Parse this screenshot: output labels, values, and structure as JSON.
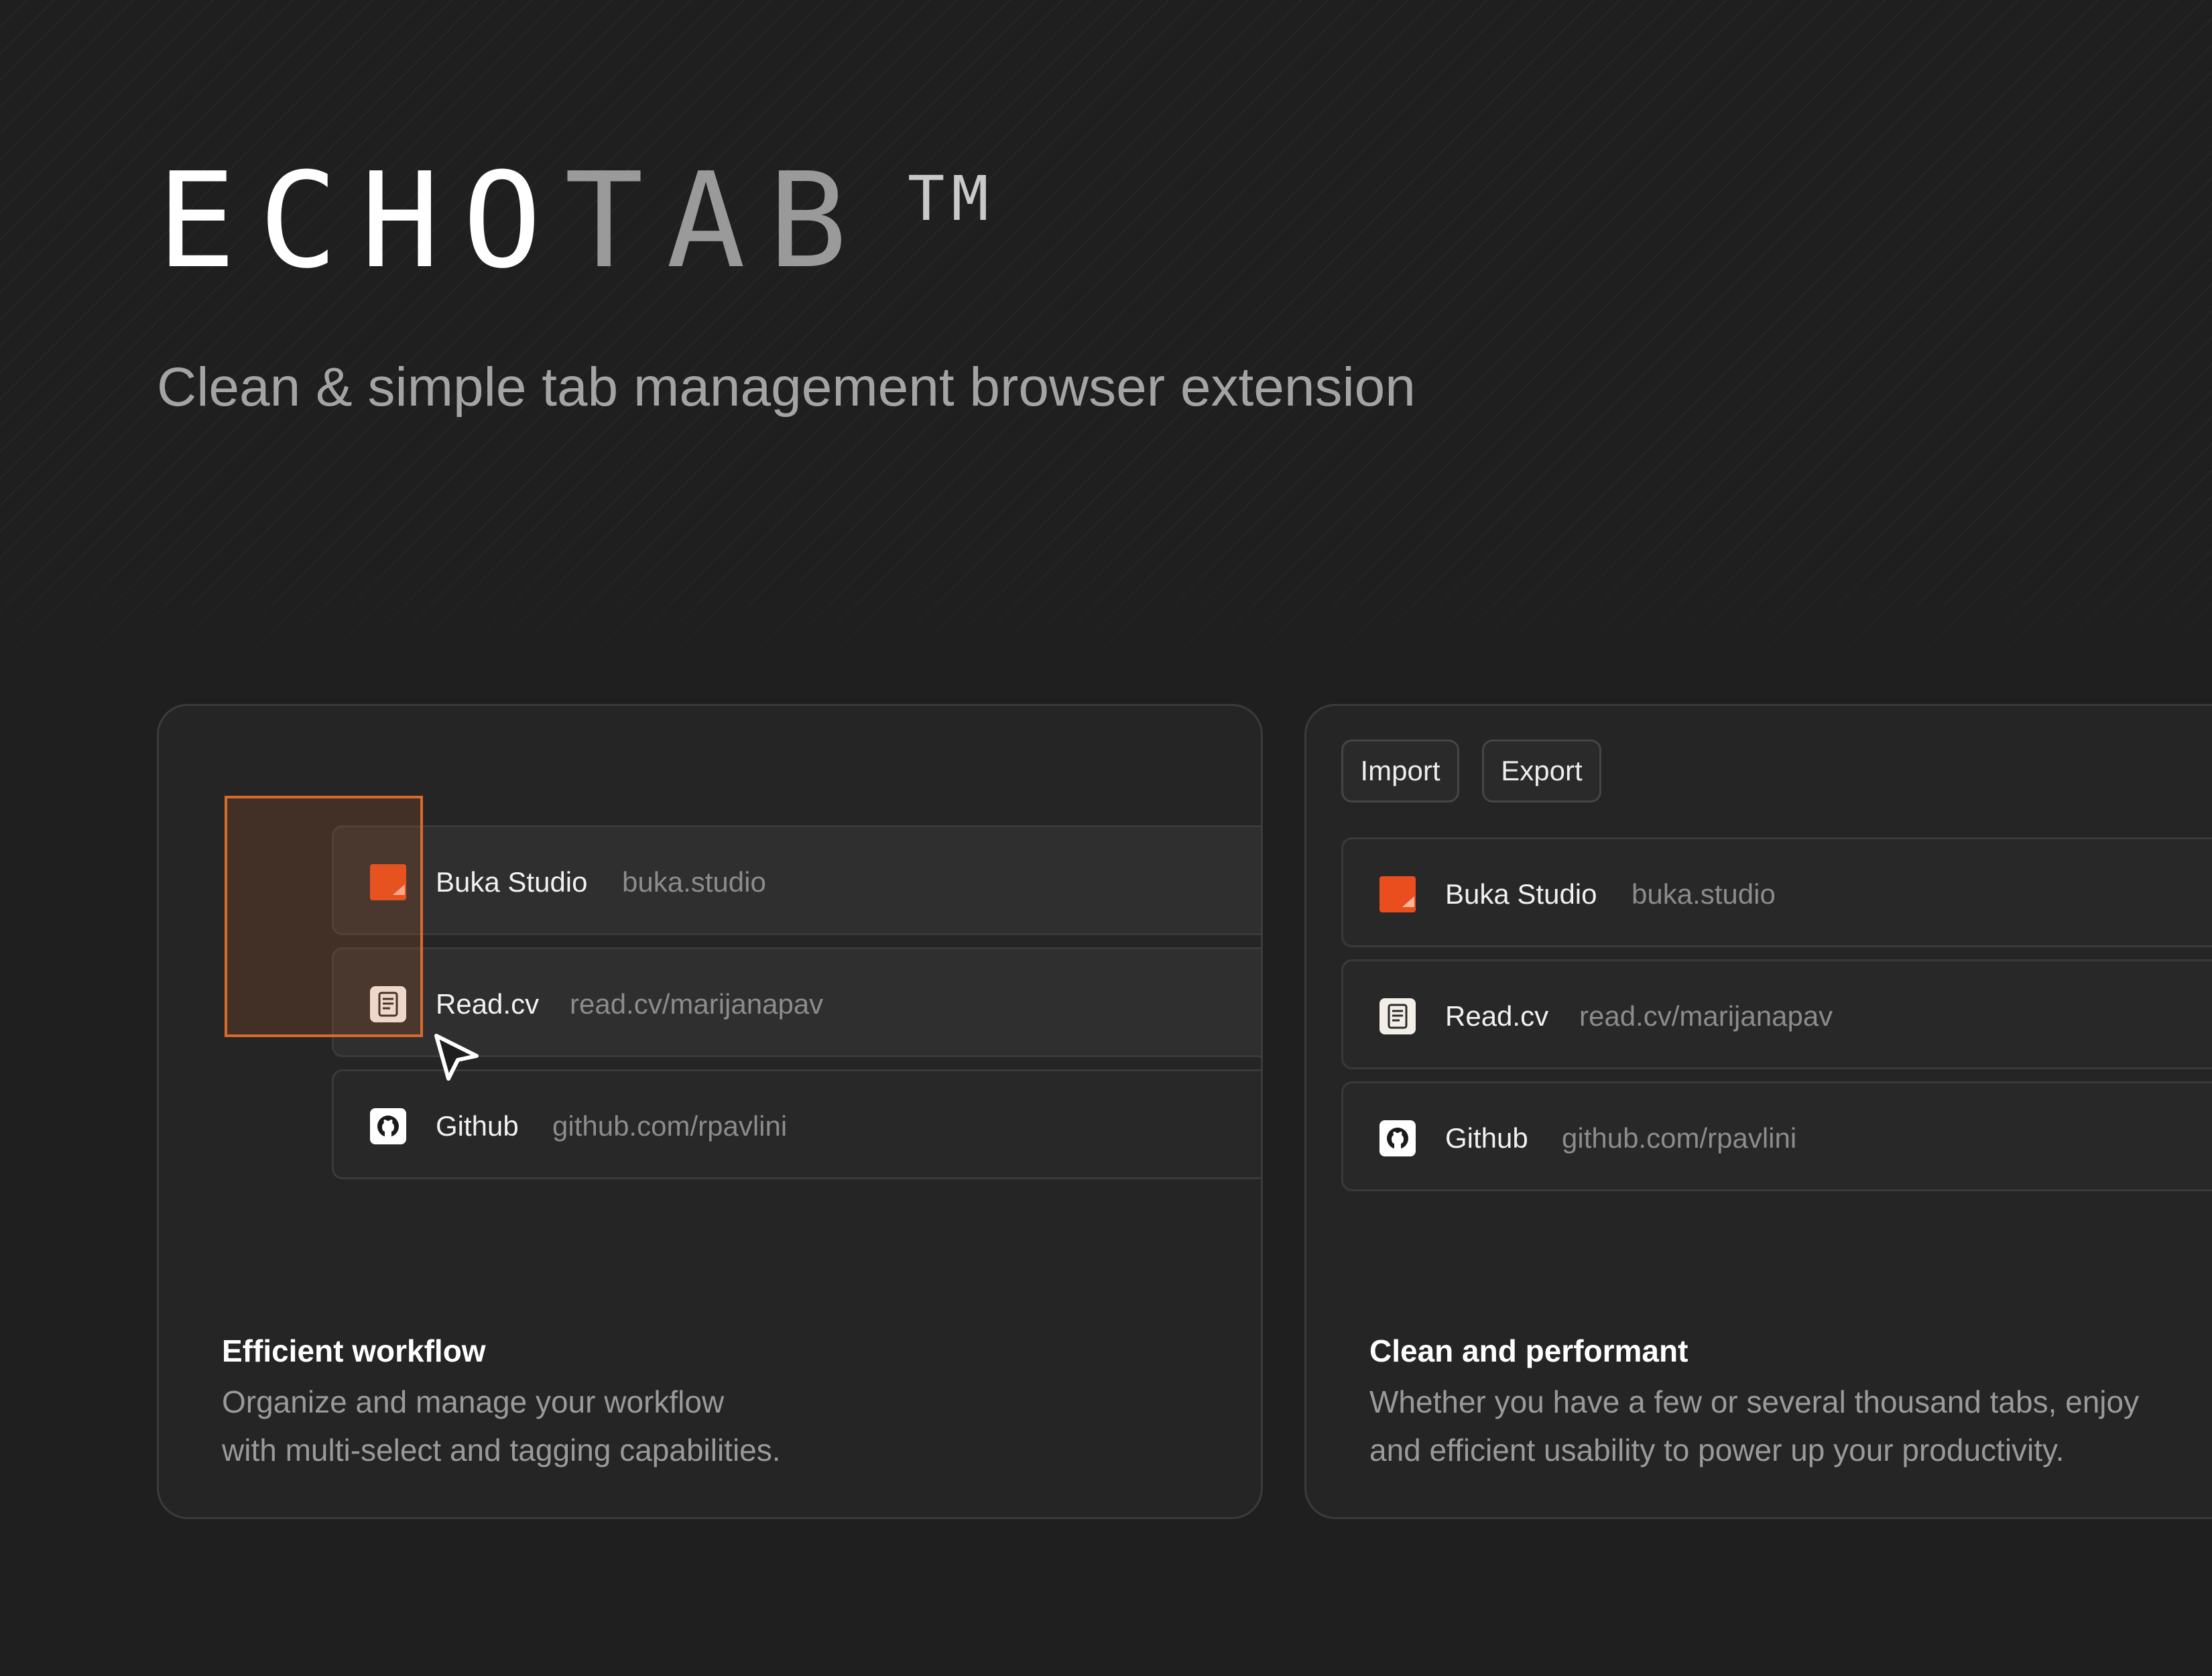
{
  "hero": {
    "logo_part1": "ECHO",
    "logo_part2": "TAB",
    "logo_tm": "TM",
    "subtitle": "Clean & simple tab management browser extension"
  },
  "left_card": {
    "tabs": [
      {
        "name": "Buka Studio",
        "url": "buka.studio",
        "icon": "buka-studio-icon"
      },
      {
        "name": "Read.cv",
        "url": "read.cv/marijanapav",
        "icon": "readcv-icon"
      },
      {
        "name": "Github",
        "url": "github.com/rpavlini",
        "icon": "github-icon"
      }
    ],
    "feature": {
      "title": "Efficient workflow",
      "desc_line1": "Organize and manage your workflow",
      "desc_line2": "with multi-select and tagging capabilities."
    }
  },
  "right_card": {
    "buttons": {
      "import": "Import",
      "export": "Export"
    },
    "tabs": [
      {
        "name": "Buka Studio",
        "url": "buka.studio",
        "icon": "buka-studio-icon"
      },
      {
        "name": "Read.cv",
        "url": "read.cv/marijanapav",
        "icon": "readcv-icon"
      },
      {
        "name": "Github",
        "url": "github.com/rpavlini",
        "icon": "github-icon"
      }
    ],
    "feature": {
      "title": "Clean and performant",
      "desc_line1": "Whether you have a few or several thousand tabs, enjoy",
      "desc_line2": "and efficient usability to power up your productivity."
    }
  },
  "colors": {
    "background": "#1f1f1f",
    "card": "#252525",
    "accent_orange": "#d96a2b",
    "brand_buka": "#ea4e1f"
  }
}
